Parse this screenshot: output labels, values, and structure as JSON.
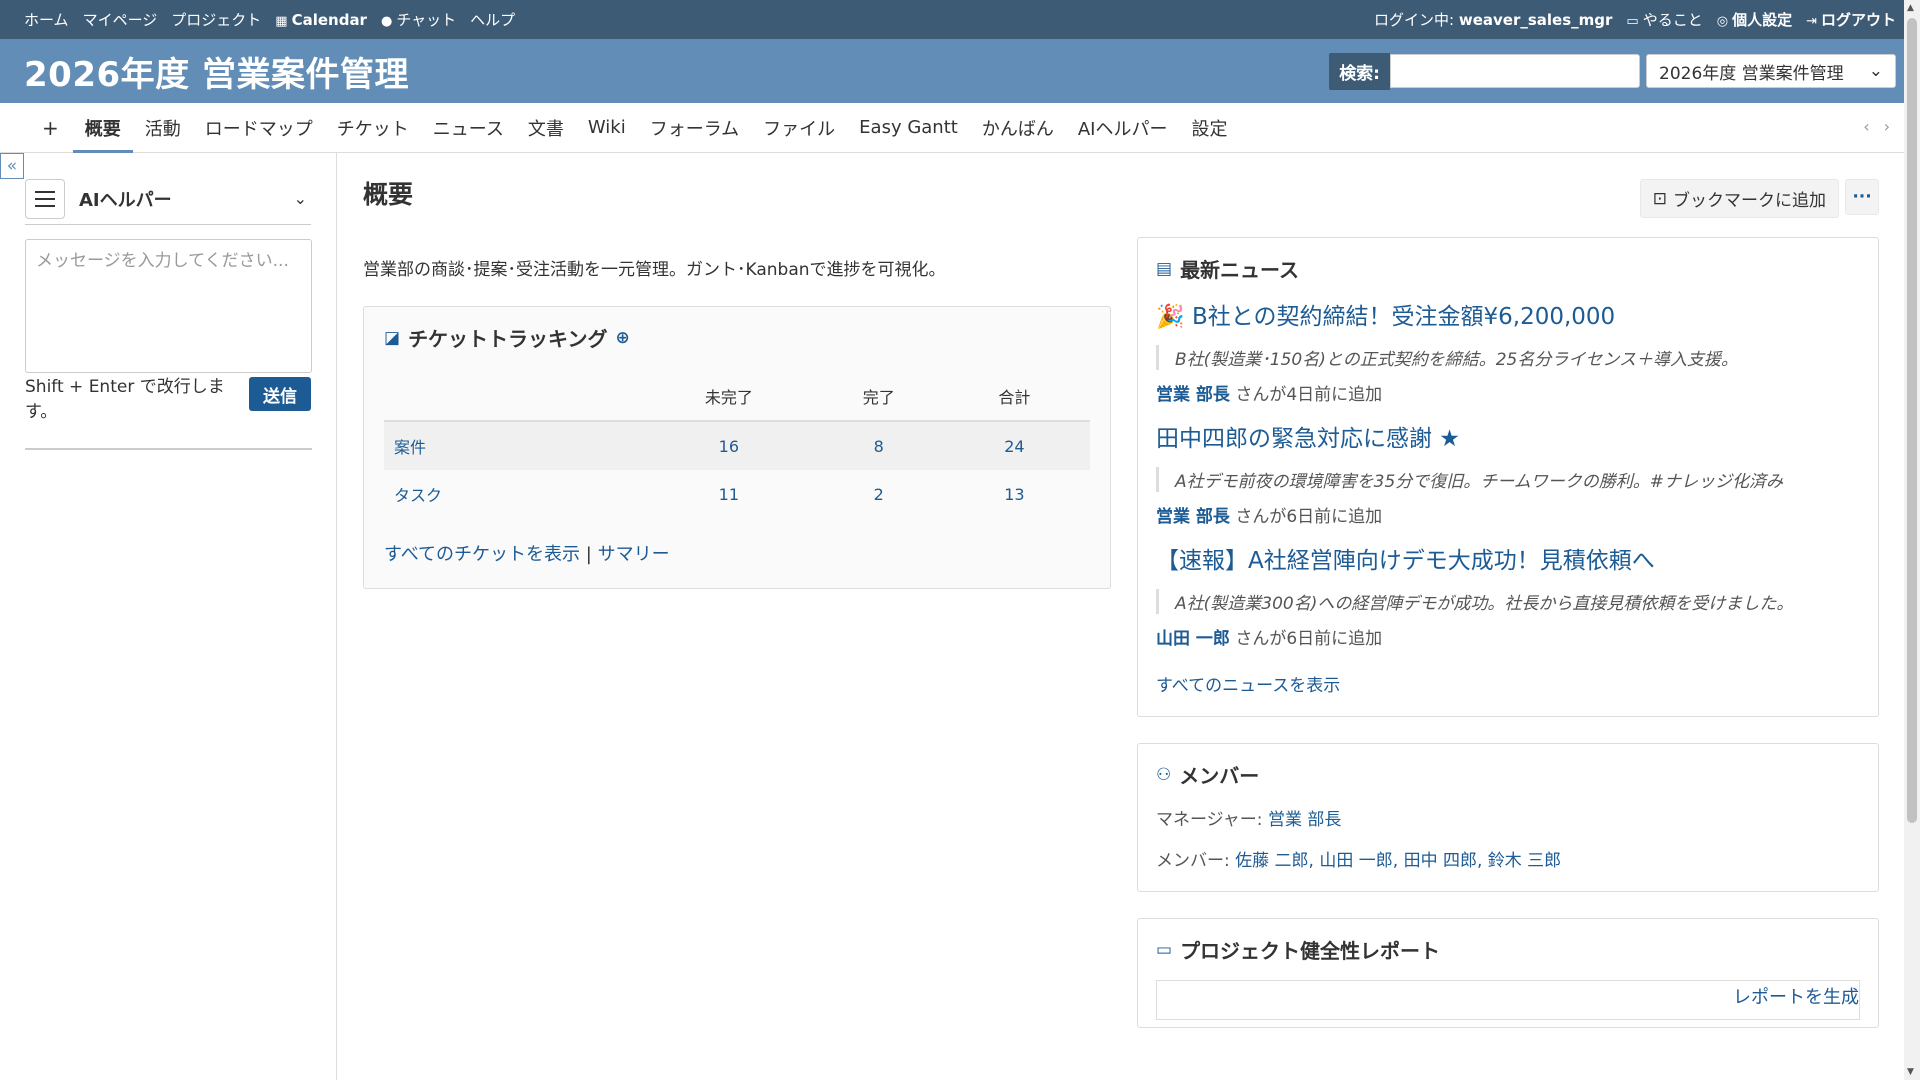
{
  "top_menu": {
    "left": [
      "ホーム",
      "マイページ",
      "プロジェクト",
      "Calendar",
      "チャット",
      "ヘルプ"
    ],
    "login_prefix": "ログイン中:",
    "login_user": "weaver_sales_mgr",
    "todo": "やること",
    "settings": "個人設定",
    "logout": "ログアウト"
  },
  "header": {
    "title": "2026年度 営業案件管理",
    "search_label": "検索:",
    "search_value": "",
    "project_select": "2026年度 営業案件管理"
  },
  "tabs": [
    "+",
    "概要",
    "活動",
    "ロードマップ",
    "チケット",
    "ニュース",
    "文書",
    "Wiki",
    "フォーラム",
    "ファイル",
    "Easy Gantt",
    "かんばん",
    "AIヘルパー",
    "設定"
  ],
  "selected_tab": 1,
  "sidebar": {
    "ai_title": "AIヘルパー",
    "message_placeholder": "メッセージを入力してください...",
    "hint": "Shift + Enter で改行します。",
    "send": "送信"
  },
  "content": {
    "title": "概要",
    "bookmark": "ブックマークに追加",
    "more": "···",
    "description": "営業部の商談･提案･受注活動を一元管理。ガント･Kanbanで進捗を可視化。"
  },
  "tracking": {
    "title": "チケットトラッキング",
    "headers": [
      "",
      "未完了",
      "完了",
      "合計"
    ],
    "rows": [
      {
        "name": "案件",
        "open": "16",
        "closed": "8",
        "total": "24"
      },
      {
        "name": "タスク",
        "open": "11",
        "closed": "2",
        "total": "13"
      }
    ],
    "link_all": "すべてのチケットを表示",
    "separator": "|",
    "link_summary": "サマリー"
  },
  "news": {
    "title": "最新ニュース",
    "items": [
      {
        "title": "🎉 B社との契約締結！受注金額¥6,200,000",
        "desc": "B社(製造業･150名)との正式契約を締結。25名分ライセンス＋導入支援。",
        "author": "営業 部長",
        "meta": "さんが4日前に追加"
      },
      {
        "title": "田中四郎の緊急対応に感謝 ★",
        "desc": "A社デモ前夜の環境障害を35分で復旧。チームワークの勝利。#ナレッジ化済み",
        "author": "営業 部長",
        "meta": "さんが6日前に追加"
      },
      {
        "title": "【速報】A社経営陣向けデモ大成功！見積依頼へ",
        "desc": "A社(製造業300名)への経営陣デモが成功。社長から直接見積依頼を受けました。",
        "author": "山田 一郎",
        "meta": "さんが6日前に追加"
      }
    ],
    "link_all": "すべてのニュースを表示"
  },
  "members": {
    "title": "メンバー",
    "manager_label": "マネージャー:",
    "manager": "営業 部長",
    "member_label": "メンバー:",
    "members": "佐藤 二郎, 山田 一郎, 田中 四郎, 鈴木 三郎"
  },
  "health": {
    "title": "プロジェクト健全性レポート",
    "generate": "レポートを生成"
  }
}
